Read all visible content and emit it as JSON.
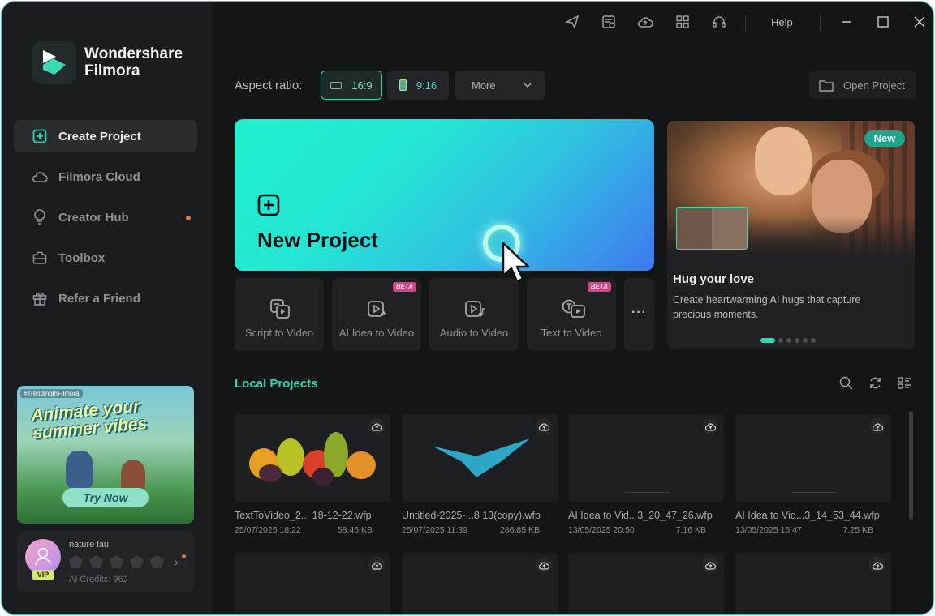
{
  "app": {
    "name_line1": "Wondershare",
    "name_line2": "Filmora"
  },
  "titlebar": {
    "help_label": "Help",
    "icons": [
      "send-icon",
      "task-list-icon",
      "cloud-icon",
      "grid-apps-icon",
      "headset-icon",
      "minimize-icon",
      "maximize-icon",
      "close-icon"
    ]
  },
  "sidebar": {
    "items": [
      {
        "label": "Create Project",
        "icon": "plus-square-icon",
        "active": true
      },
      {
        "label": "Filmora Cloud",
        "icon": "cloud-icon",
        "active": false
      },
      {
        "label": "Creator Hub",
        "icon": "bulb-icon",
        "active": false,
        "has_dot": true
      },
      {
        "label": "Toolbox",
        "icon": "toolbox-icon",
        "active": false
      },
      {
        "label": "Refer a Friend",
        "icon": "gift-icon",
        "active": false
      }
    ],
    "promo": {
      "tag": "#TrendinginFilmora",
      "headline": "Animate your summer vibes",
      "cta": "Try Now"
    },
    "user": {
      "name": "nature lau",
      "badge": "VIP",
      "credits": "AI Credits: 962"
    }
  },
  "toolbar": {
    "aspect_label": "Aspect ratio:",
    "ratio_169": "16:9",
    "ratio_916": "9:16",
    "more_label": "More",
    "open_project_label": "Open Project"
  },
  "hero": {
    "title": "New Project"
  },
  "features": [
    {
      "label": "Script to Video",
      "icon": "script-video-icon",
      "beta": false
    },
    {
      "label": "AI Idea to Video",
      "icon": "ai-idea-icon",
      "beta": true
    },
    {
      "label": "Audio to Video",
      "icon": "audio-video-icon",
      "beta": false
    },
    {
      "label": "Text to Video",
      "icon": "text-video-icon",
      "beta": true
    }
  ],
  "beta_label": "BETA",
  "more_dots": "···",
  "banner": {
    "badge": "New",
    "title": "Hug your love",
    "description": "Create heartwarming AI hugs that capture precious moments.",
    "active_slide": 1,
    "slide_count": 6
  },
  "local_projects": {
    "title": "Local Projects",
    "items": [
      {
        "name": "TextToVideo_2... 18-12-22.wfp",
        "date": "25/07/2025 18:22",
        "size": "58.46 KB"
      },
      {
        "name": "Untitled-2025-...8 13(copy).wfp",
        "date": "25/07/2025 11:39",
        "size": "286.85 KB"
      },
      {
        "name": "AI Idea to Vid...3_20_47_26.wfp",
        "date": "13/05/2025 20:50",
        "size": "7.16 KB"
      },
      {
        "name": "AI Idea to Vid...3_14_53_44.wfp",
        "date": "13/05/2025 15:47",
        "size": "7.25 KB"
      }
    ]
  },
  "colors": {
    "accent": "#2ed6ae",
    "background": "#141517",
    "sidebar": "#1b1c1f"
  }
}
